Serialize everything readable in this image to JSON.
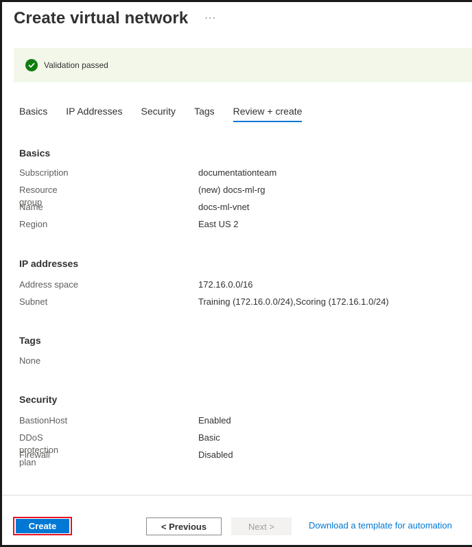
{
  "header": {
    "title": "Create virtual network",
    "more": "···"
  },
  "banner": {
    "text": "Validation passed",
    "color": "#107c10"
  },
  "tabs": [
    {
      "label": "Basics"
    },
    {
      "label": "IP Addresses"
    },
    {
      "label": "Security"
    },
    {
      "label": "Tags"
    },
    {
      "label": "Review + create",
      "active": true
    }
  ],
  "basics": {
    "title": "Basics",
    "rows": [
      {
        "key": "Subscription",
        "value": "documentationteam"
      },
      {
        "key": "Resource group",
        "value": "(new) docs-ml-rg"
      },
      {
        "key": "Name",
        "value": "docs-ml-vnet"
      },
      {
        "key": "Region",
        "value": "East US 2"
      }
    ]
  },
  "ip": {
    "title": "IP addresses",
    "rows": [
      {
        "key": "Address space",
        "value": "172.16.0.0/16"
      },
      {
        "key": "Subnet",
        "value": "Training (172.16.0.0/24),Scoring (172.16.1.0/24)"
      }
    ]
  },
  "tags": {
    "title": "Tags",
    "rows": [
      {
        "key": "None",
        "value": ""
      }
    ]
  },
  "security": {
    "title": "Security",
    "rows": [
      {
        "key": "BastionHost",
        "value": "Enabled"
      },
      {
        "key": "DDoS protection plan",
        "value": "Basic"
      },
      {
        "key": "Firewall",
        "value": "Disabled"
      }
    ]
  },
  "footer": {
    "create": "Create",
    "previous": "< Previous",
    "next": "Next >",
    "download": "Download a template for automation"
  },
  "colors": {
    "accent": "#0078d4",
    "highlight": "#e81123"
  }
}
